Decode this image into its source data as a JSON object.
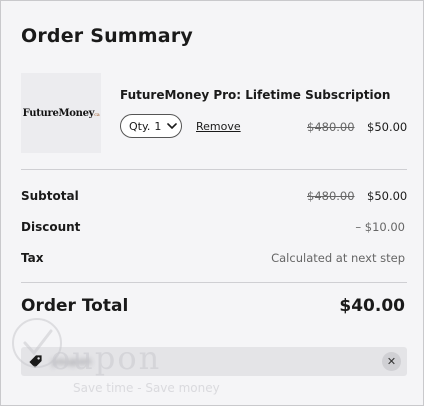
{
  "summary": {
    "title": "Order Summary"
  },
  "item": {
    "thumbnail_logo": "FutureMoney",
    "thumbnail_logo_suffix": "ca",
    "name": "FutureMoney Pro: Lifetime Subscription",
    "qty_label": "Qty.",
    "qty_value": "1",
    "remove_label": "Remove",
    "old_price": "$480.00",
    "new_price": "$50.00"
  },
  "totals": {
    "subtotal_label": "Subtotal",
    "subtotal_old": "$480.00",
    "subtotal_new": "$50.00",
    "discount_label": "Discount",
    "discount_value": "– $10.00",
    "tax_label": "Tax",
    "tax_value": "Calculated at next step",
    "order_total_label": "Order Total",
    "order_total_value": "$40.00"
  },
  "coupon": {
    "code": "youpon",
    "icon": "tag-icon",
    "remove_icon": "close-icon"
  },
  "watermark": {
    "word": "oupon",
    "slogan": "Save time - Save money"
  }
}
